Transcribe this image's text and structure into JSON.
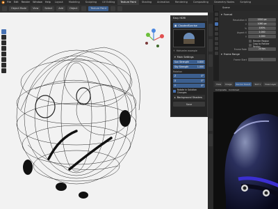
{
  "topbar": {
    "menus": [
      "File",
      "Edit",
      "Render",
      "Window",
      "Help"
    ],
    "workspaces": [
      "Layout",
      "Modeling",
      "Sculpting",
      "UV Editing",
      "Texture Paint",
      "Shading",
      "Animation",
      "Rendering",
      "Compositing",
      "Geometry Nodes",
      "Scripting"
    ],
    "active_workspace": "Texture Paint"
  },
  "viewport_header": {
    "mode": "Object Mode",
    "view": "View",
    "select": "Select",
    "add": "Add",
    "object": "Object",
    "shading_dropdown": "Texture Paint"
  },
  "panel": {
    "title": "Easy HDRI",
    "preset": "CloudedSunrise",
    "hdri_note": "Hdrismlm example",
    "main_settings": "Main Settings",
    "sun_strength_label": "Sun Strength",
    "sun_strength_value": "0.800",
    "sky_strength_label": "Sky Strength",
    "sky_strength_value": "1.000",
    "rotation_label": "Rotation",
    "z_label": "Z",
    "z_value": "0°",
    "x_label": "X",
    "x_value": "0°",
    "y_label": "Y",
    "y_value": "0°",
    "rotate_checkbox": "Rotate in Solution Changes",
    "background": "Background Shaders",
    "save": "Save"
  },
  "outliner": {
    "label": "Scene"
  },
  "properties": {
    "format_label": "Format",
    "rows": [
      {
        "label": "Resolution X",
        "value": "1920 px"
      },
      {
        "label": "Y",
        "value": "1080 px"
      },
      {
        "label": "%",
        "value": "100%"
      },
      {
        "label": "Aspect X",
        "value": "1.000"
      },
      {
        "label": "Y",
        "value": "1.000"
      }
    ],
    "render_region": "Render Region",
    "crop_region": "Crop to Render Region",
    "frame_rate_label": "Frame Rate",
    "frame_rate_value": "24 fps",
    "frame_range_label": "Frame Range",
    "frame_start_label": "Frame Start",
    "frame_start_value": "1"
  },
  "render_header": {
    "view": "View",
    "image": "Image",
    "render_result": "Render Result",
    "slot": "Slot 1",
    "layer": "View Layer"
  },
  "render_subheader": {
    "items": [
      "Composite",
      "Combined"
    ]
  },
  "colors": {
    "accent": "#4772b3",
    "viewport_bg": "#f2f2f2",
    "ui_bg": "#2b2b2b"
  }
}
